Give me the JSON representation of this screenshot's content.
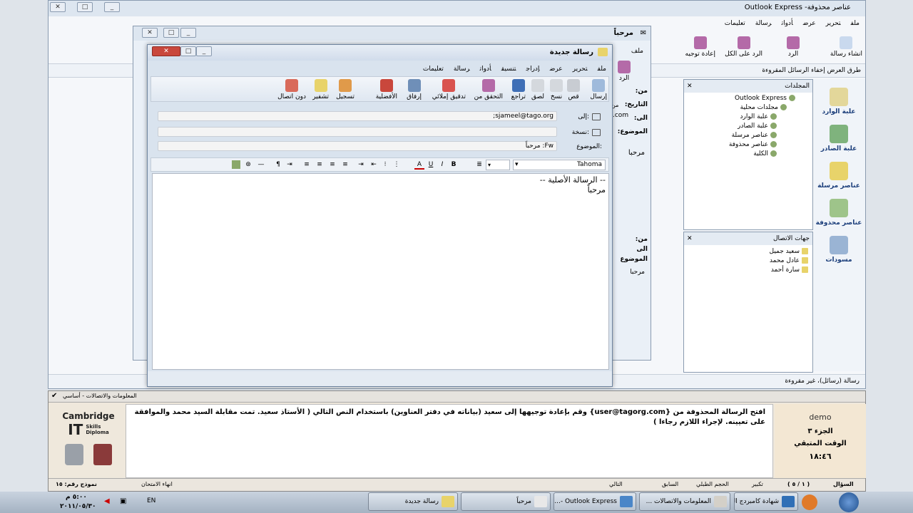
{
  "main_window": {
    "title": "Outlook Express -عناصر محذوفة",
    "menu": [
      "ملف",
      "تحرير",
      "عرض",
      "أدوات",
      "رسالة",
      "تعليمات"
    ],
    "toolbar": [
      {
        "label": "انشاء رسالة",
        "icon": "new-mail-icon"
      },
      {
        "label": "الرد",
        "icon": "reply-icon"
      },
      {
        "label": "الرد على الكل",
        "icon": "reply-all-icon"
      },
      {
        "label": "إعادة توجيه",
        "icon": "forward-icon"
      }
    ],
    "view_bar": "طرق العرض إخفاء الرسائل المقروءة",
    "left_nav": [
      {
        "label": "علبة الوارد",
        "icon": "inbox-icon"
      },
      {
        "label": "علبة الصادر",
        "icon": "outbox-icon"
      },
      {
        "label": "عناصر مرسلة",
        "icon": "sent-icon"
      },
      {
        "label": "عناصر محذوفة",
        "icon": "trash-icon"
      },
      {
        "label": "مسودات",
        "icon": "drafts-icon"
      }
    ],
    "folders_header": "المجلدات",
    "folders": [
      "Outlook Express",
      "مجلدات محلية",
      "علبة الوارد",
      "علبة الصادر",
      "عناصر مرسلة",
      "عناصر محذوفة",
      "الكلية"
    ],
    "contacts_header": "جهات الاتصال",
    "contacts": [
      "سعيد جميل",
      "عادل محمد",
      "سارة أحمد"
    ],
    "status": "رسالة (رسائل)، غير مقروءة"
  },
  "msg_window": {
    "title": "مرحباً",
    "menu": [
      "ملف"
    ],
    "reply_label": "الرد",
    "labels": [
      "من:",
      "التاريخ:",
      "الى:",
      "الموضوع:"
    ],
    "from_partial": "من",
    "email_partial": ".com",
    "body": "مرحبا",
    "lower_labels": [
      "من:",
      "الى",
      "الموضوع"
    ],
    "lower_body": "مرحبا"
  },
  "compose": {
    "title": "رسالة جديدة",
    "menu": [
      "ملف",
      "تحرير",
      "عرض",
      "إدراج",
      "تنسيق",
      "أدوات",
      "رسالة",
      "تعليمات"
    ],
    "toolbar": [
      {
        "label": "إرسال",
        "icon": "send-icon"
      },
      {
        "label": "قص",
        "icon": "cut-icon"
      },
      {
        "label": "نسخ",
        "icon": "copy-icon"
      },
      {
        "label": "لصق",
        "icon": "paste-icon"
      },
      {
        "label": "تراجع",
        "icon": "undo-icon"
      },
      {
        "label": "التحقق من",
        "icon": "check-names-icon"
      },
      {
        "label": "تدقيق إملائي",
        "icon": "spelling-icon"
      },
      {
        "label": "إرفاق",
        "icon": "attach-icon"
      },
      {
        "label": "الأفضلية",
        "icon": "priority-icon"
      },
      {
        "label": "تسجيل",
        "icon": "sign-icon"
      },
      {
        "label": "تشفير",
        "icon": "encrypt-icon"
      },
      {
        "label": "دون اتصال",
        "icon": "offline-icon"
      }
    ],
    "to_label": "إلى:",
    "cc_label": "نسخة:",
    "subject_label": "الموضوع:",
    "to_value": "sjameel@tago.org;",
    "cc_value": "",
    "subject_value": "Fw: مرحباً",
    "font": "Tahoma",
    "body_lines": [
      "-- الرسالة الأصلية --",
      "مرحباً"
    ]
  },
  "exam": {
    "header": "المعلومات والاتصالات - أساسي",
    "logo_lines": [
      "Cambridge",
      "IT",
      "Skills",
      "Diploma"
    ],
    "question": "افتح الرسالة المحذوفة من {user@tagorg.com} وقم بإعادة توجيهها إلى سعيد (بياناته في دفتر العناوين) باستخدام النص التالي ( الأستاذ سعيد. تمت مقابلة السيد محمد والموافقة على تعيينه. لإجراء اللازم رجاءا )",
    "demo": "demo",
    "part": "الجزء ٣",
    "time_label": "الوقت المتبقي",
    "time": "١٨:٤٦",
    "q_label": "السؤال",
    "q_value": "( ١ / ٥ )",
    "model": "نموذج رقم: ١٥",
    "buttons": [
      "تكبير",
      "الحجم الطبلي",
      "السابق",
      "التالي",
      "انهاء الامتحان"
    ]
  },
  "taskbar": {
    "items": [
      "شهادة كامبردج الد...",
      "المعلومات والاتصالات ...",
      "Outlook Express -...",
      "مرحباً",
      "رسالة جديدة"
    ],
    "lang": "EN",
    "time": "٥:٠٠ م",
    "date": "٢٠١١/٠٥/٣٠"
  }
}
